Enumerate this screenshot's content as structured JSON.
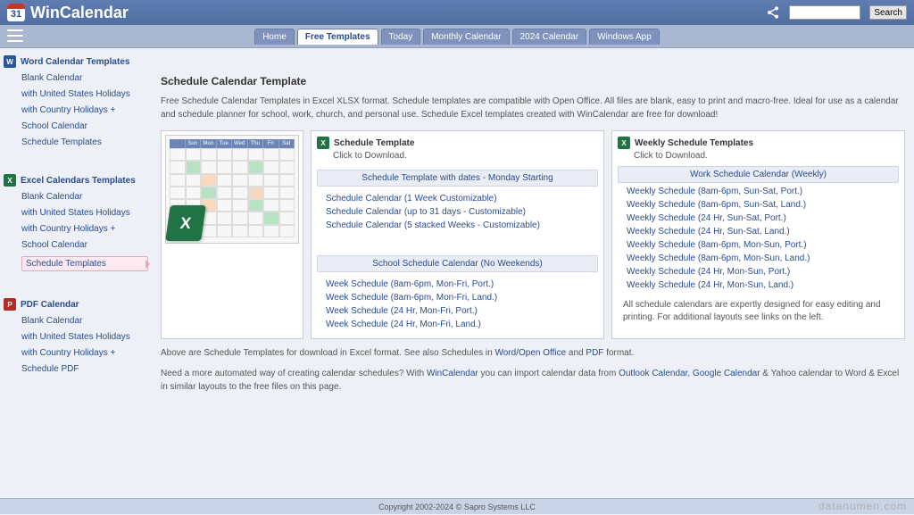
{
  "app": {
    "logo_number": "31",
    "title": "WinCalendar",
    "search_placeholder": "",
    "search_btn": "Search"
  },
  "nav": {
    "tabs": [
      "Home",
      "Free Templates",
      "Today",
      "Monthly Calendar",
      "2024 Calendar",
      "Windows App"
    ],
    "active_index": 1
  },
  "sidebar": {
    "sections": [
      {
        "icon": "word",
        "glyph": "W",
        "title": "Word Calendar Templates",
        "items": [
          "Blank Calendar",
          "with United States Holidays",
          "with Country Holidays +",
          "School Calendar",
          "Schedule Templates"
        ],
        "sel": -1
      },
      {
        "icon": "excel",
        "glyph": "X",
        "title": "Excel Calendars Templates",
        "items": [
          "Blank Calendar",
          "with United States Holidays",
          "with Country Holidays +",
          "School Calendar",
          "Schedule Templates"
        ],
        "sel": 4
      },
      {
        "icon": "pdf",
        "glyph": "P",
        "title": "PDF Calendar",
        "items": [
          "Blank Calendar",
          "with United States Holidays",
          "with Country Holidays +",
          "Schedule PDF"
        ],
        "sel": -1
      }
    ]
  },
  "page": {
    "heading": "Schedule Calendar Template",
    "intro": "Free Schedule Calendar Templates in Excel XLSX format. Schedule templates are compatible with Open Office. All files are blank, easy to print and macro-free. Ideal for use as a calendar and schedule planner for school, work, church, and personal use. Schedule Excel templates created with WinCalendar are free for download!",
    "thumb_days": [
      "",
      "Sun",
      "Mon",
      "Tue",
      "Wed",
      "Thu",
      "Fri",
      "Sat"
    ],
    "col_mid": {
      "head": "Schedule Template",
      "sub": "Click to Download.",
      "group1_title": "Schedule Template with dates - Monday Starting",
      "group1_links": [
        "Schedule Calendar (1 Week Customizable)",
        "Schedule Calendar (up to 31 days - Customizable)",
        "Schedule Calendar (5 stacked Weeks - Customizable)"
      ],
      "group2_title": "School Schedule Calendar (No Weekends)",
      "group2_links": [
        "Week Schedule (8am-6pm, Mon-Fri, Port.)",
        "Week Schedule (8am-6pm, Mon-Fri, Land.)",
        "Week Schedule (24 Hr, Mon-Fri, Port.)",
        "Week Schedule (24 Hr, Mon-Fri, Land.)"
      ]
    },
    "col_right": {
      "head": "Weekly Schedule Templates",
      "sub": "Click to Download.",
      "group_title": "Work Schedule Calendar (Weekly)",
      "links": [
        "Weekly Schedule (8am-6pm, Sun-Sat, Port.)",
        "Weekly Schedule (8am-6pm, Sun-Sat, Land.)",
        "Weekly Schedule (24 Hr, Sun-Sat, Port.)",
        "Weekly Schedule (24 Hr, Sun-Sat, Land.)",
        "Weekly Schedule (8am-6pm, Mon-Sun, Port.)",
        "Weekly Schedule (8am-6pm, Mon-Sun, Land.)",
        "Weekly Schedule (24 Hr, Mon-Sun, Port.)",
        "Weekly Schedule (24 Hr, Mon-Sun, Land.)"
      ],
      "note": "All schedule calendars are expertly designed for easy editing and printing. For additional layouts see links on the left."
    },
    "bottom1_a": "Above are Schedule Templates for download in Excel format. See also Schedules in ",
    "bottom1_l1": "Word/Open Office",
    "bottom1_b": " and ",
    "bottom1_l2": "PDF",
    "bottom1_c": " format.",
    "bottom2_a": "Need a more automated way of creating calendar schedules? With ",
    "bottom2_l1": "WinCalendar",
    "bottom2_b": " you can import calendar data from ",
    "bottom2_l2": "Outlook Calendar",
    "bottom2_c": ", ",
    "bottom2_l3": "Google Calendar",
    "bottom2_d": " & Yahoo calendar to Word & Excel in similar layouts to the free files on this page."
  },
  "footer": "Copyright 2002-2024 © Sapro Systems LLC",
  "watermark": "datanumen.com"
}
